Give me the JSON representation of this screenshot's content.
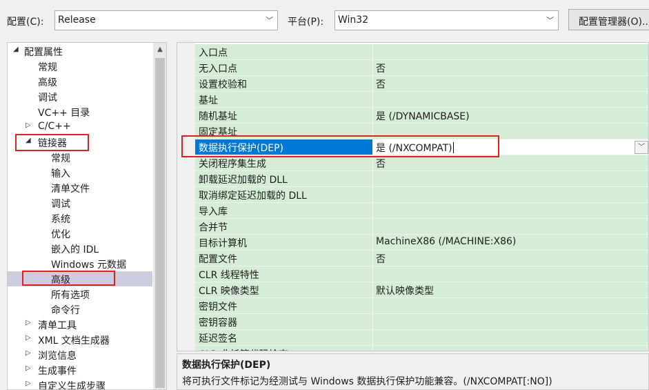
{
  "toolbar": {
    "config_label": "配置(C):",
    "config_value": "Release",
    "platform_label": "平台(P):",
    "platform_value": "Win32",
    "manager_button": "配置管理器(O)..."
  },
  "tree": {
    "items": [
      {
        "label": "配置属性",
        "toggle": "expanded"
      },
      {
        "label": "常规"
      },
      {
        "label": "高级"
      },
      {
        "label": "调试"
      },
      {
        "label": "VC++ 目录"
      },
      {
        "label": "C/C++",
        "toggle": "collapsed"
      },
      {
        "label": "链接器",
        "toggle": "expanded"
      },
      {
        "label": "常规"
      },
      {
        "label": "输入"
      },
      {
        "label": "清单文件"
      },
      {
        "label": "调试"
      },
      {
        "label": "系统"
      },
      {
        "label": "优化"
      },
      {
        "label": "嵌入的 IDL"
      },
      {
        "label": "Windows 元数据"
      },
      {
        "label": "高级",
        "selected": true
      },
      {
        "label": "所有选项"
      },
      {
        "label": "命令行"
      },
      {
        "label": "清单工具",
        "toggle": "collapsed"
      },
      {
        "label": "XML 文档生成器",
        "toggle": "collapsed"
      },
      {
        "label": "浏览信息",
        "toggle": "collapsed"
      },
      {
        "label": "生成事件",
        "toggle": "collapsed"
      },
      {
        "label": "自定义生成步骤",
        "toggle": "collapsed"
      }
    ]
  },
  "grid": {
    "rows": [
      {
        "name": "入口点",
        "value": ""
      },
      {
        "name": "无入口点",
        "value": "否"
      },
      {
        "name": "设置校验和",
        "value": "否"
      },
      {
        "name": "基址",
        "value": ""
      },
      {
        "name": "随机基址",
        "value": "是 (/DYNAMICBASE)"
      },
      {
        "name": "固定基址",
        "value": ""
      },
      {
        "name": "数据执行保护(DEP)",
        "value": "是 (/NXCOMPAT)",
        "selected": true
      },
      {
        "name": "关闭程序集生成",
        "value": "否"
      },
      {
        "name": "卸载延迟加载的 DLL",
        "value": ""
      },
      {
        "name": "取消绑定延迟加载的 DLL",
        "value": ""
      },
      {
        "name": "导入库",
        "value": ""
      },
      {
        "name": "合并节",
        "value": ""
      },
      {
        "name": "目标计算机",
        "value": "MachineX86 (/MACHINE:X86)"
      },
      {
        "name": "配置文件",
        "value": "否"
      },
      {
        "name": "CLR 线程特性",
        "value": ""
      },
      {
        "name": "CLR 映像类型",
        "value": "默认映像类型"
      },
      {
        "name": "密钥文件",
        "value": ""
      },
      {
        "name": "密钥容器",
        "value": ""
      },
      {
        "name": "延迟签名",
        "value": ""
      },
      {
        "name": "CLR 非托管代码检查",
        "value": ""
      }
    ]
  },
  "description": {
    "title": "数据执行保护(DEP)",
    "text": "将可执行文件标记为经测试与 Windows 数据执行保护功能兼容。(/NXCOMPAT[:NO])"
  },
  "icons": {
    "expanded": "◢",
    "collapsed": "▷",
    "dropdown": "﹀",
    "scroll_up": "▲"
  },
  "colors": {
    "selection": "#0078d7",
    "grid_row": "#d5ecd6",
    "highlight_box": "#e02020",
    "tree_selection": "#cdcde0"
  }
}
